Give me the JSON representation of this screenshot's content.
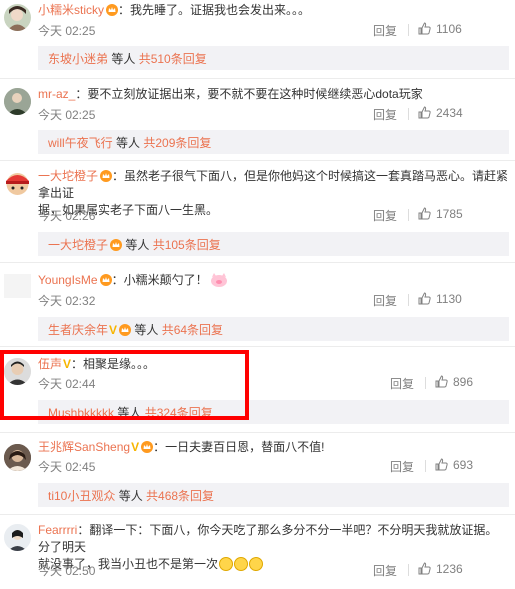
{
  "comments": [
    {
      "user": "小糯米sticky",
      "text": "：我先睡了。证据我也会发出来。。。",
      "time": "今天 02:25",
      "reply_label": "回复",
      "likes": "1106",
      "reply_user": "东坡小迷弟",
      "reply_suffix": " 等人 ",
      "reply_count": "共510条回复"
    },
    {
      "user": "mr-az_",
      "text": "：要不立刻放证据出来，要不就不要在这种时候继续恶心dota玩家",
      "time": "今天 02:25",
      "reply_label": "回复",
      "likes": "2434",
      "reply_user": "will午夜飞行",
      "reply_suffix": " 等人 ",
      "reply_count": "共209条回复"
    },
    {
      "user": "一大坨橙子",
      "text_line1": "：虽然老子很气下面八，但是你他妈这个时候搞这一套真踏马恶心。请赶紧拿出证",
      "text_line2": "据，如果属实老子下面八一生黑。",
      "time": "今天 02:26",
      "reply_label": "回复",
      "likes": "1785",
      "reply_user": "一大坨橙子",
      "reply_suffix": " 等人 ",
      "reply_count": "共105条回复"
    },
    {
      "user": "YoungIsMe",
      "text": "：小糯米颠勺了！",
      "time": "今天 02:32",
      "reply_label": "回复",
      "likes": "1130",
      "reply_user": "生者庆余年",
      "reply_suffix": " 等人 ",
      "reply_count": "共64条回复"
    },
    {
      "user": "伍声",
      "text": "：相聚是缘。。。",
      "time": "今天 02:44",
      "reply_label": "回复",
      "likes": "896",
      "reply_user": "Mushbkkkkk",
      "reply_suffix": " 等人 ",
      "reply_count": "共324条回复"
    },
    {
      "user": "王兆辉SanSheng",
      "text": "：一日夫妻百日恩，替面八不值!",
      "time": "今天 02:45",
      "reply_label": "回复",
      "likes": "693",
      "reply_user": "ti10小丑观众",
      "reply_suffix": " 等人 ",
      "reply_count": "共468条回复"
    },
    {
      "user": "Fearrrri",
      "text_line1": "：翻译一下：下面八，你今天吃了那么多分不分一半吧？不分明天我就放证据。分了明天",
      "text_line2": "就没事了，我当小丑也不是第一次",
      "time": "今天 02:50",
      "reply_label": "回复",
      "likes": "1236"
    }
  ],
  "icons": {
    "like": "thumbs-up-icon",
    "crown": "crown-badge-icon",
    "verified": "v-badge-icon"
  },
  "verified_mark": "V",
  "colors": {
    "username": "#eb7350",
    "meta": "#808080",
    "reply_bg": "#f2f2f5",
    "highlight": "#ff0000"
  }
}
